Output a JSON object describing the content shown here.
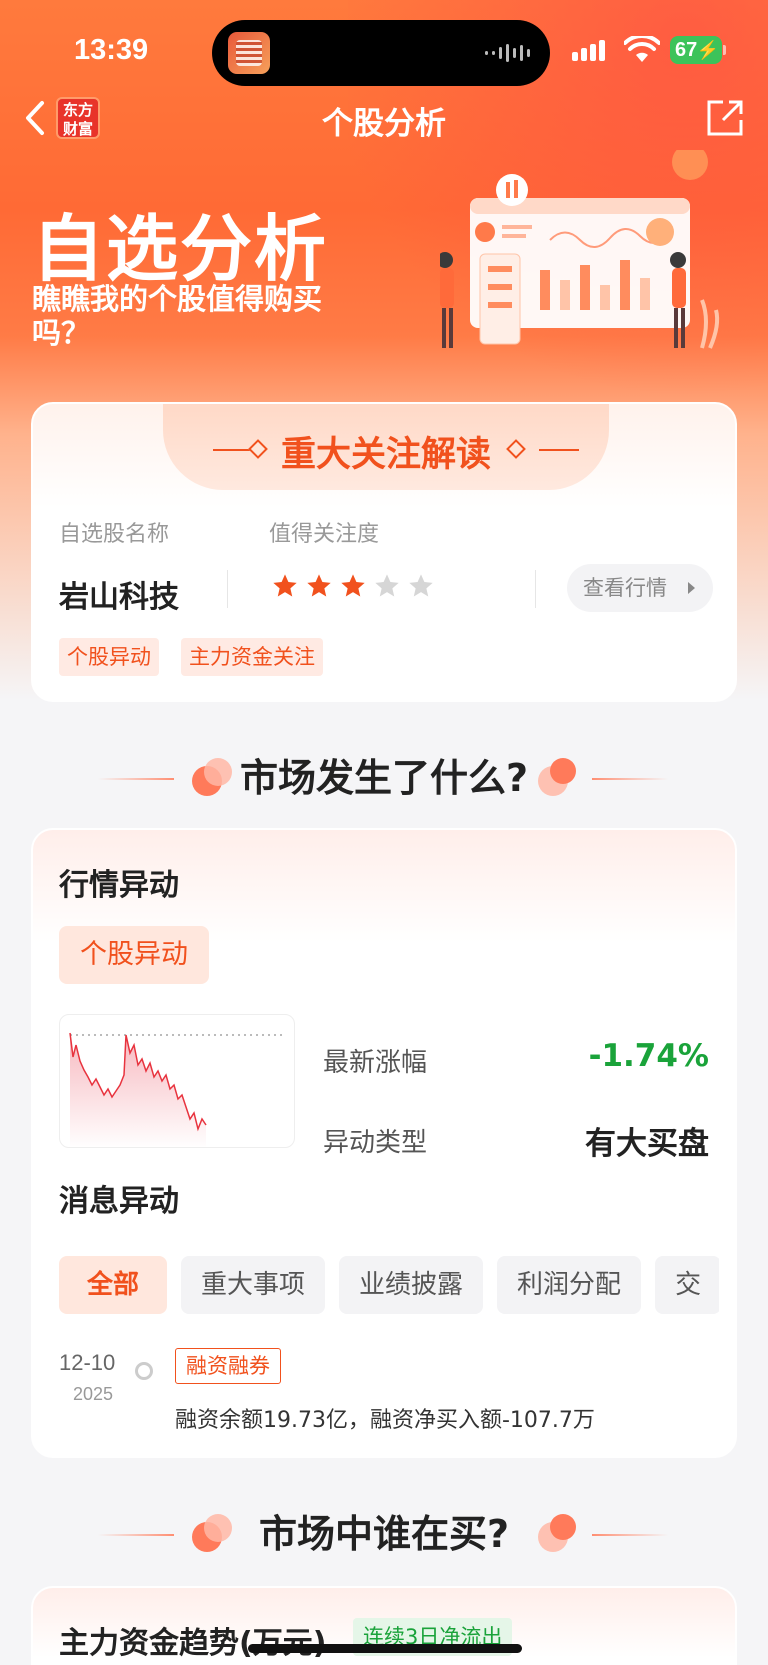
{
  "status_bar": {
    "time": "13:39",
    "battery": "67"
  },
  "nav": {
    "logo_line1": "东方",
    "logo_line2": "财富",
    "title": "个股分析"
  },
  "hero": {
    "title": "自选分析",
    "subtitle": "瞧瞧我的个股值得购买吗？"
  },
  "focus_card": {
    "heading": "重大关注解读",
    "name_label": "自选股名称",
    "rating_label": "值得关注度",
    "stock_name": "岩山科技",
    "rating": 3,
    "rating_max": 5,
    "view_button": "查看行情",
    "tags": [
      "个股异动",
      "主力资金关注"
    ]
  },
  "section1": {
    "title": "市场发生了什么?"
  },
  "market_card": {
    "title": "行情异动",
    "subtag": "个股异动",
    "latest_change_label": "最新涨幅",
    "latest_change_value": "-1.74%",
    "anomaly_type_label": "异动类型",
    "anomaly_type_value": "有大买盘",
    "news_title": "消息异动",
    "filters": [
      "全部",
      "重大事项",
      "业绩披露",
      "利润分配",
      "交"
    ],
    "news": {
      "date": "12-10",
      "year": "2025",
      "tag": "融资融券",
      "text": "融资余额19.73亿，融资净买入额-107.7万"
    }
  },
  "section2": {
    "title": "市场中谁在买?"
  },
  "fund_card": {
    "title": "主力资金趋势(万元)",
    "tag": "连续3日净流出"
  },
  "colors": {
    "accent": "#f1511d",
    "down": "#1aa33a",
    "up": "#e8332a"
  }
}
